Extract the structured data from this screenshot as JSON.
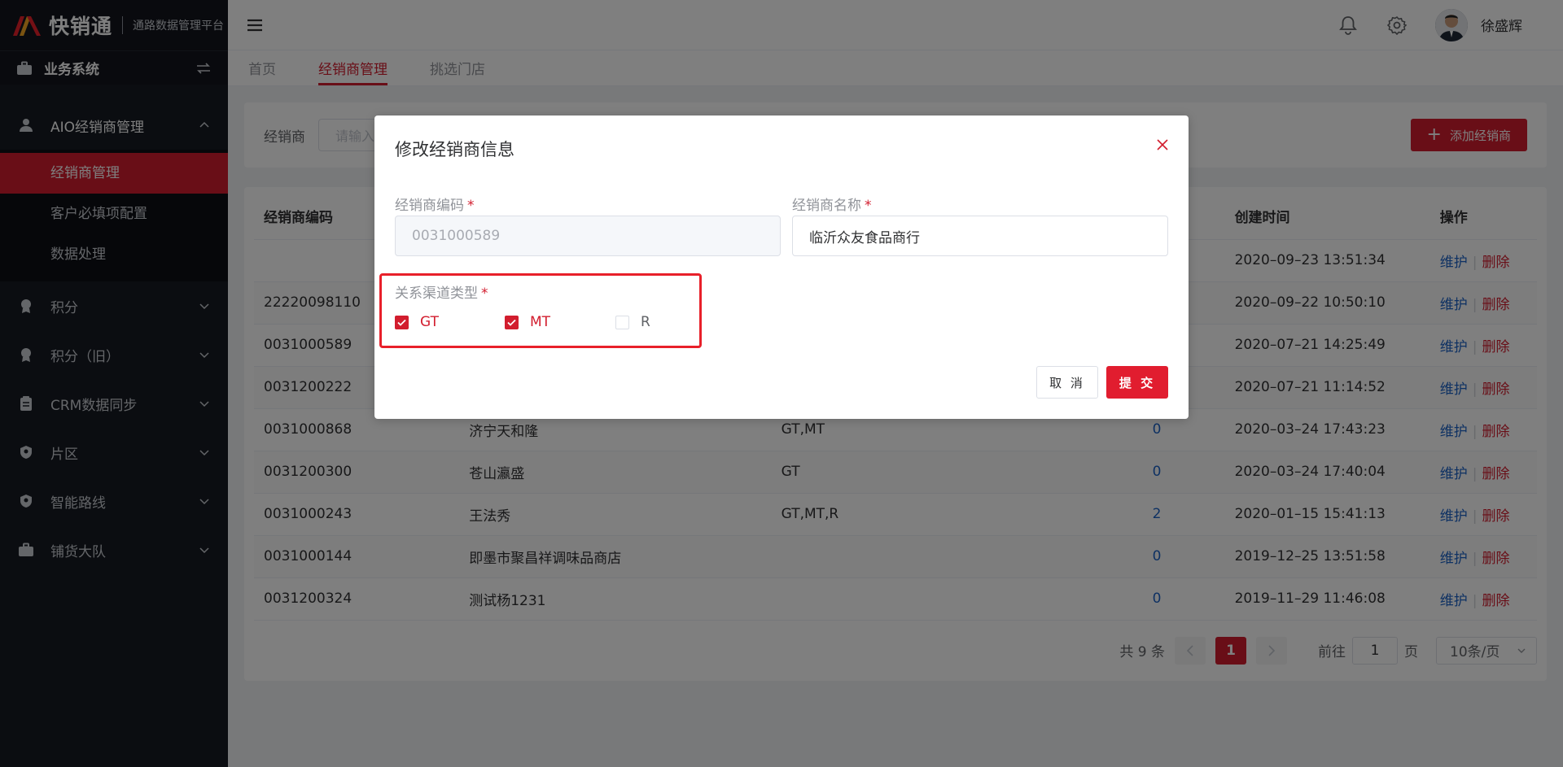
{
  "brand": {
    "name": "快销通",
    "subtitle": "通路数据管理平台",
    "accent": "#d21d2e"
  },
  "sidebar": {
    "system": {
      "label": "业务系统",
      "icon": "briefcase-icon"
    },
    "groups": [
      {
        "label": "AIO经销商管理",
        "icon": "user-icon",
        "open": true,
        "children": [
          {
            "label": "经销商管理",
            "active": true
          },
          {
            "label": "客户必填项配置"
          },
          {
            "label": "数据处理"
          }
        ]
      },
      {
        "label": "积分",
        "icon": "medal-icon"
      },
      {
        "label": "积分（旧）",
        "icon": "medal-icon"
      },
      {
        "label": "CRM数据同步",
        "icon": "clipboard-icon"
      },
      {
        "label": "片区",
        "icon": "shield-icon"
      },
      {
        "label": "智能路线",
        "icon": "shield-icon"
      },
      {
        "label": "铺货大队",
        "icon": "briefcase-icon"
      }
    ]
  },
  "header": {
    "username": "徐盛辉"
  },
  "tabs": [
    {
      "label": "首页"
    },
    {
      "label": "经销商管理",
      "active": true
    },
    {
      "label": "挑选门店"
    }
  ],
  "filter": {
    "label": "经销商",
    "placeholder": "请输入经",
    "add_button": "添加经销商"
  },
  "table": {
    "headers": {
      "code": "经销商编码",
      "time": "创建时间",
      "action": "操作"
    },
    "action_edit": "维护",
    "action_delete": "删除",
    "rows": [
      {
        "code": "",
        "name": "",
        "type": "",
        "count": "",
        "time": "2020–09–23 13:51:34"
      },
      {
        "code": "22220098110",
        "name": "",
        "type": "",
        "count": "",
        "time": "2020–09–22 10:50:10"
      },
      {
        "code": "0031000589",
        "name": "",
        "type": "",
        "count": "",
        "time": "2020–07–21 14:25:49"
      },
      {
        "code": "0031200222",
        "name": "",
        "type": "",
        "count": "",
        "time": "2020–07–21 11:14:52"
      },
      {
        "code": "0031000868",
        "name": "济宁天和隆",
        "type": "GT,MT",
        "count": "0",
        "time": "2020–03–24 17:43:23"
      },
      {
        "code": "0031200300",
        "name": "苍山瀛盛",
        "type": "GT",
        "count": "0",
        "time": "2020–03–24 17:40:04"
      },
      {
        "code": "0031000243",
        "name": "王法秀",
        "type": "GT,MT,R",
        "count": "2",
        "time": "2020–01–15 15:41:13"
      },
      {
        "code": "0031000144",
        "name": "即墨市聚昌祥调味品商店",
        "type": "",
        "count": "0",
        "time": "2019–12–25 13:51:58"
      },
      {
        "code": "0031200324",
        "name": "测试杨1231",
        "type": "",
        "count": "0",
        "time": "2019–11–29 11:46:08"
      }
    ]
  },
  "pager": {
    "total": "共 9 条",
    "current": "1",
    "goto_label": "前往",
    "goto_value": "1",
    "page_unit": "页",
    "page_size": "10条/页"
  },
  "dialog": {
    "title": "修改经销商信息",
    "code_label": "经销商编码",
    "code_value": "0031000589",
    "name_label": "经销商名称",
    "name_value": "临沂众友食品商行",
    "channel_label": "关系渠道类型",
    "channels": [
      {
        "label": "GT",
        "checked": true
      },
      {
        "label": "MT",
        "checked": true
      },
      {
        "label": "R",
        "checked": false
      }
    ],
    "cancel": "取 消",
    "submit": "提 交"
  }
}
